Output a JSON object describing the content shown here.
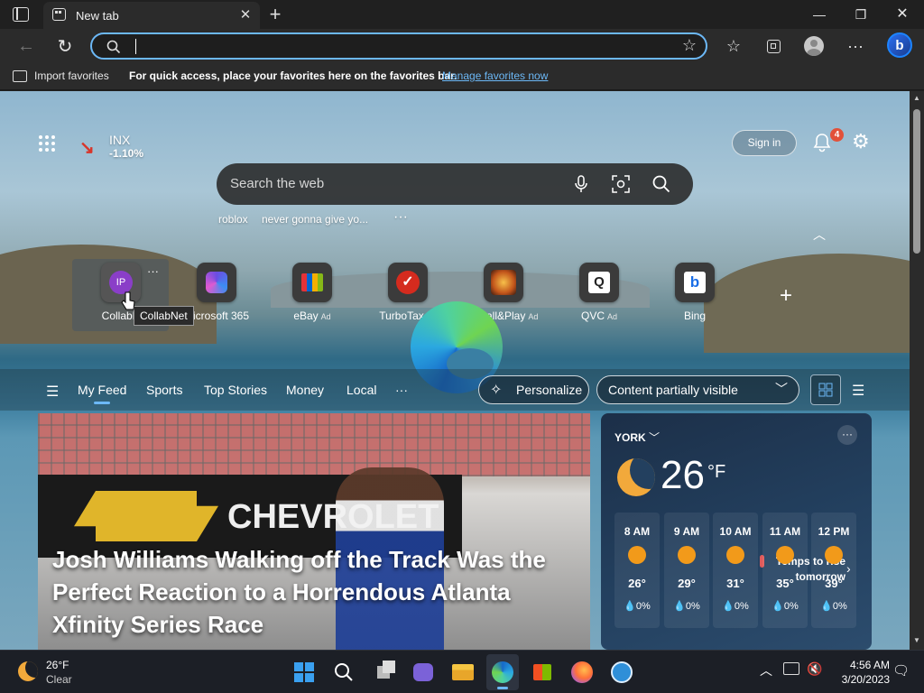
{
  "window": {
    "tab_title": "New tab",
    "icons": [
      "tab-actions-icon",
      "new-tab-page-icon",
      "close-icon",
      "plus-icon",
      "minimize-icon",
      "restore-icon",
      "close-icon"
    ]
  },
  "toolbar": {
    "address_value": "",
    "icons": [
      "back-icon",
      "refresh-icon",
      "search-icon",
      "add-favorite-icon",
      "favorites-icon",
      "collections-icon",
      "profile-icon",
      "more-icon",
      "bing-icon"
    ]
  },
  "favbar": {
    "import_label": "Import favorites",
    "message": "For quick access, place your favorites here on the favorites bar.",
    "manage_link": "Manage favorites now"
  },
  "ntp": {
    "stock_symbol": "INX",
    "stock_change": "-1.10%",
    "sign_in": "Sign in",
    "notification_count": "4",
    "search_placeholder": "Search the web",
    "suggestions": [
      "roblox",
      "never gonna give yo...",
      "···"
    ],
    "tiles": [
      {
        "name": "CollabN",
        "ad": "",
        "initials": "IP"
      },
      {
        "name": "Microsoft 365",
        "ad": ""
      },
      {
        "name": "eBay",
        "ad": "Ad"
      },
      {
        "name": "TurboTax",
        "ad": "Ad"
      },
      {
        "name": "Install&Play",
        "ad": "Ad"
      },
      {
        "name": "QVC",
        "ad": "Ad"
      },
      {
        "name": "Bing",
        "ad": ""
      }
    ],
    "tooltip": "CollabNet",
    "tile_more": "···",
    "feed_tabs": [
      "My Feed",
      "Sports",
      "Top Stories",
      "Money",
      "Local",
      "···"
    ],
    "personalize": "Personalize",
    "content_visibility": "Content partially visible",
    "hero_headline": "Josh Williams Walking off the Track Was the Perfect Reaction to a Horrendous Atlanta Xfinity Series Race",
    "hero_sign_text": "CHEVROLET"
  },
  "weather": {
    "location": "YORK",
    "temp": "26",
    "unit": "°F",
    "note": "Temps to rise tomorrow",
    "more": "···",
    "hours": [
      {
        "time": "8 AM",
        "temp": "26°",
        "precip": "0%"
      },
      {
        "time": "9 AM",
        "temp": "29°",
        "precip": "0%"
      },
      {
        "time": "10 AM",
        "temp": "31°",
        "precip": "0%"
      },
      {
        "time": "11 AM",
        "temp": "35°",
        "precip": "0%"
      },
      {
        "time": "12 PM",
        "temp": "39°",
        "precip": "0%"
      }
    ]
  },
  "taskbar": {
    "weather_temp": "26°F",
    "weather_desc": "Clear",
    "time": "4:56 AM",
    "date": "3/20/2023",
    "apps": [
      "start-icon",
      "search-icon",
      "task-view-icon",
      "chat-icon",
      "file-explorer-icon",
      "edge-icon",
      "store-icon",
      "firefox-icon",
      "app-icon"
    ]
  },
  "colors": {
    "accent": "#6cb8f6",
    "link": "#6cb8f6",
    "notification_badge": "#e2513a",
    "sun": "#f29a1a"
  }
}
